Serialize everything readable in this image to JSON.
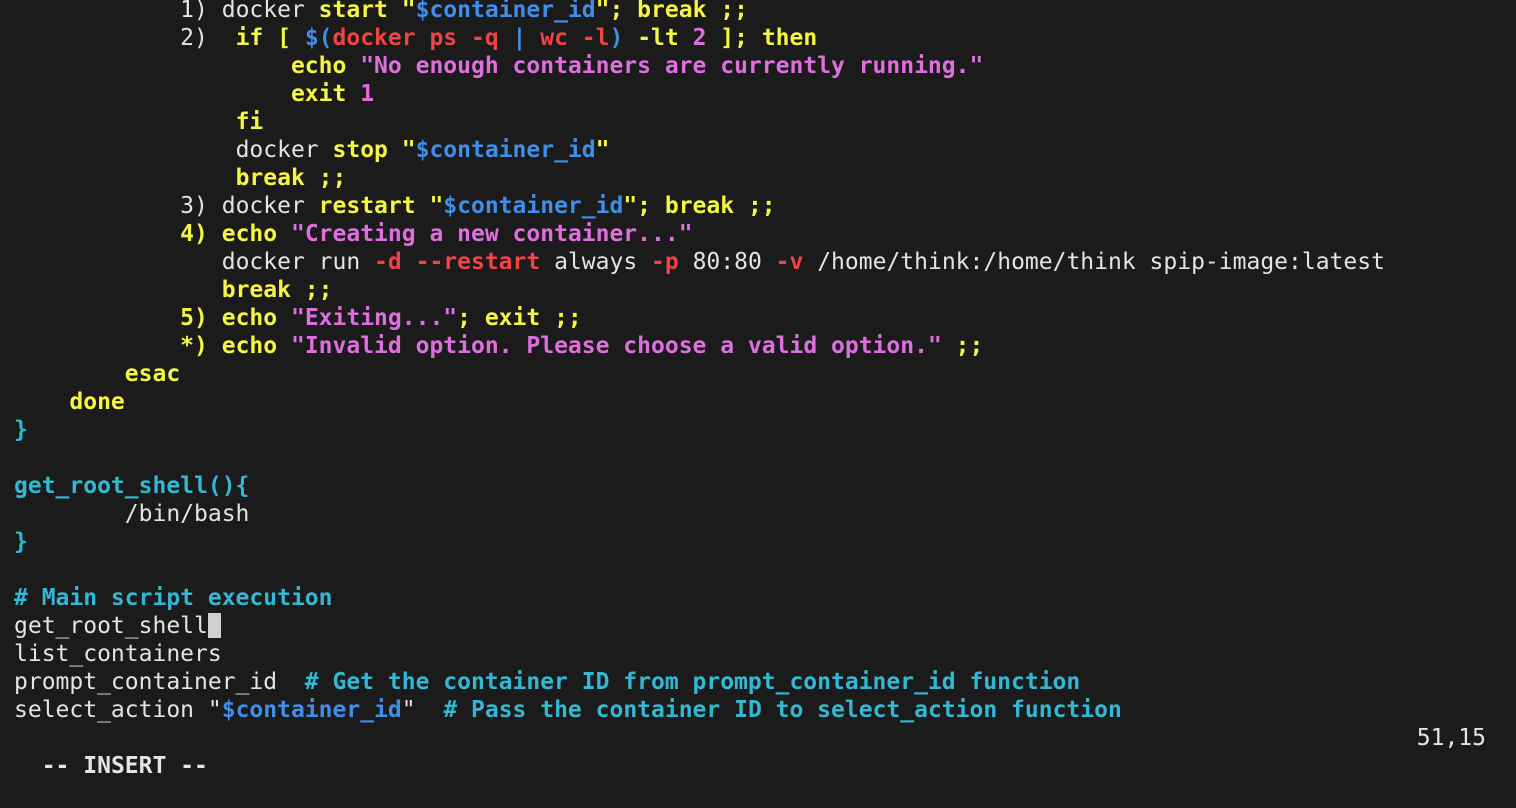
{
  "editor": {
    "lines": [
      [
        [
          "            ",
          "cmd"
        ],
        [
          "1) ",
          "cmd"
        ],
        [
          "docker ",
          "cmd"
        ],
        [
          "start ",
          "kw"
        ],
        [
          "\"",
          "kw"
        ],
        [
          "$container_id",
          "var"
        ],
        [
          "\"",
          "kw"
        ],
        [
          "; break ;;",
          "kw"
        ]
      ],
      [
        [
          "            ",
          "cmd"
        ],
        [
          "2)  ",
          "cmd"
        ],
        [
          "if [ ",
          "kw"
        ],
        [
          "$(",
          "var"
        ],
        [
          "docker ps -q ",
          "red"
        ],
        [
          "| ",
          "var"
        ],
        [
          "wc -l",
          "red"
        ],
        [
          ") ",
          "var"
        ],
        [
          "-lt ",
          "kw"
        ],
        [
          "2",
          "str"
        ],
        [
          " ]; then",
          "kw"
        ]
      ],
      [
        [
          "                    ",
          "cmd"
        ],
        [
          "echo ",
          "kw"
        ],
        [
          "\"No enough containers are currently running.\"",
          "str"
        ]
      ],
      [
        [
          "                    ",
          "cmd"
        ],
        [
          "exit ",
          "kw"
        ],
        [
          "1",
          "str"
        ]
      ],
      [
        [
          "                ",
          "cmd"
        ],
        [
          "fi",
          "kw"
        ]
      ],
      [
        [
          "                ",
          "cmd"
        ],
        [
          "docker ",
          "cmd"
        ],
        [
          "stop ",
          "kw"
        ],
        [
          "\"",
          "kw"
        ],
        [
          "$container_id",
          "var"
        ],
        [
          "\"",
          "kw"
        ]
      ],
      [
        [
          "                ",
          "cmd"
        ],
        [
          "break ;;",
          "kw"
        ]
      ],
      [
        [
          "            ",
          "cmd"
        ],
        [
          "3) ",
          "cmd"
        ],
        [
          "docker ",
          "cmd"
        ],
        [
          "restart ",
          "kw"
        ],
        [
          "\"",
          "kw"
        ],
        [
          "$container_id",
          "var"
        ],
        [
          "\"",
          "kw"
        ],
        [
          "; break ;;",
          "kw"
        ]
      ],
      [
        [
          "            ",
          "cmd"
        ],
        [
          "4) ",
          "kw"
        ],
        [
          "echo ",
          "kw"
        ],
        [
          "\"Creating a new container...\"",
          "str"
        ]
      ],
      [
        [
          "               ",
          "cmd"
        ],
        [
          "docker run ",
          "cmd"
        ],
        [
          "-d ",
          "red"
        ],
        [
          "--restart ",
          "red"
        ],
        [
          "always ",
          "cmd"
        ],
        [
          "-p ",
          "red"
        ],
        [
          "80:80 ",
          "cmd"
        ],
        [
          "-v ",
          "red"
        ],
        [
          "/home/think:/home/think spip-image:latest",
          "cmd"
        ]
      ],
      [
        [
          "               ",
          "cmd"
        ],
        [
          "break ;;",
          "kw"
        ]
      ],
      [
        [
          "            ",
          "cmd"
        ],
        [
          "5) ",
          "kw"
        ],
        [
          "echo ",
          "kw"
        ],
        [
          "\"Exiting...\"",
          "str"
        ],
        [
          "; exit ;;",
          "kw"
        ]
      ],
      [
        [
          "            ",
          "cmd"
        ],
        [
          "*) ",
          "kw"
        ],
        [
          "echo ",
          "kw"
        ],
        [
          "\"Invalid option. Please choose a valid option.\"",
          "str"
        ],
        [
          " ;;",
          "kw"
        ]
      ],
      [
        [
          "        ",
          "cmd"
        ],
        [
          "esac",
          "kw"
        ]
      ],
      [
        [
          "    ",
          "cmd"
        ],
        [
          "done",
          "kw"
        ]
      ],
      [
        [
          "}",
          "fn"
        ]
      ],
      [],
      [
        [
          "get_root_shell(){",
          "fn"
        ]
      ],
      [
        [
          "        ",
          "cmd"
        ],
        [
          "/bin/bash",
          "cmd"
        ]
      ],
      [
        [
          "}",
          "fn"
        ]
      ],
      [],
      [
        [
          "# Main script execution",
          "cmt"
        ]
      ],
      [
        [
          "get_root_shell",
          "cmd"
        ],
        [
          "",
          "cursor"
        ]
      ],
      [
        [
          "list_containers",
          "cmd"
        ]
      ],
      [
        [
          "prompt_container_id  ",
          "cmd"
        ],
        [
          "# Get the container ID from prompt_container_id function",
          "cmt"
        ]
      ],
      [
        [
          "select_action ",
          "cmd"
        ],
        [
          "\"",
          "cmd"
        ],
        [
          "$container_id",
          "var"
        ],
        [
          "\"",
          "cmd"
        ],
        [
          "  ",
          "cmd"
        ],
        [
          "# Pass the container ID to select_action function",
          "cmt"
        ]
      ]
    ]
  },
  "status": {
    "mode": "-- INSERT --",
    "position": "51,15"
  }
}
